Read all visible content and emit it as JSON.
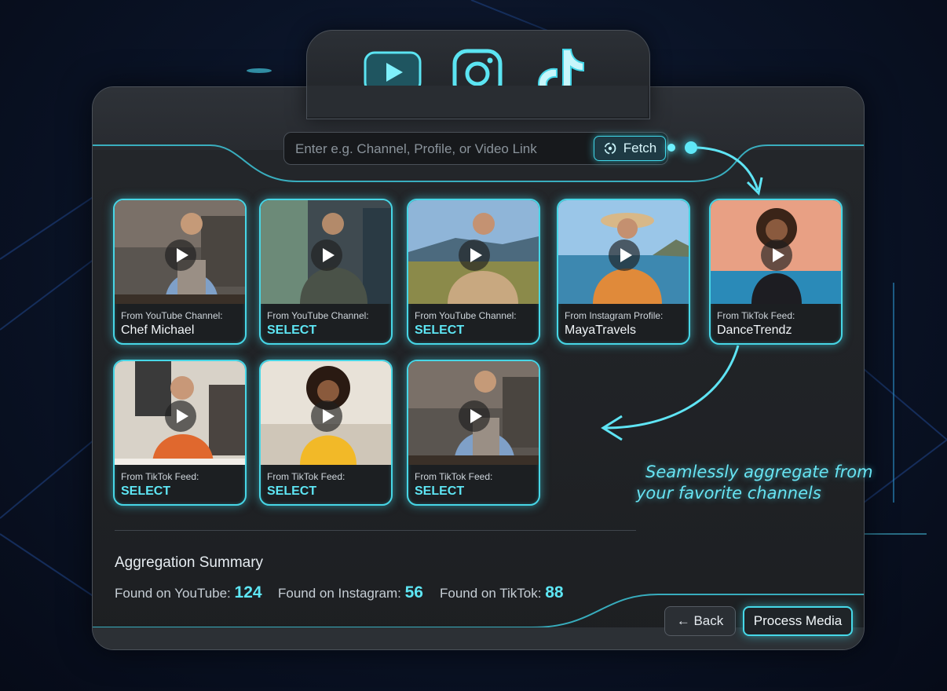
{
  "platforms": [
    {
      "name": "youtube-icon"
    },
    {
      "name": "instagram-icon"
    },
    {
      "name": "tiktok-icon"
    }
  ],
  "search": {
    "placeholder": "Enter e.g. Channel, Profile, or Video Link",
    "fetch_label": "Fetch"
  },
  "cards": [
    {
      "source": "From YouTube Channel:",
      "name": "Chef Michael"
    },
    {
      "source": "From YouTube Channel:",
      "name": "SELECT"
    },
    {
      "source": "From YouTube Channel:",
      "name": "SELECT"
    },
    {
      "source": "From Instagram Profile:",
      "name": "MayaTravels"
    },
    {
      "source": "From TikTok Feed:",
      "name": "DanceTrendz"
    },
    {
      "source": "From TikTok Feed:",
      "name": "SELECT"
    },
    {
      "source": "From TikTok Feed:",
      "name": "SELECT"
    },
    {
      "source": "From TikTok Feed:",
      "name": "SELECT"
    }
  ],
  "annotation": {
    "line1": "Seamlessly aggregate from",
    "line2": "your favorite channels"
  },
  "summary": {
    "title": "Aggregation Summary",
    "youtube_label": "Found on YouTube:",
    "youtube_count": "124",
    "instagram_label": "Found on Instagram:",
    "instagram_count": "56",
    "tiktok_label": "Found on TikTok:",
    "tiktok_count": "88"
  },
  "actions": {
    "back_label": "← Back",
    "process_label": "Process Media"
  },
  "colors": {
    "accent": "#47d6e6",
    "panel": "#24272b",
    "background": "#0a1326"
  }
}
